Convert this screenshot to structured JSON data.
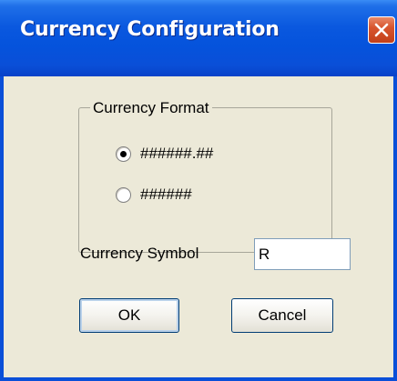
{
  "window": {
    "title": "Currency Configuration"
  },
  "titlebar": {
    "close_icon": "close-x-icon"
  },
  "currency_format": {
    "legend": "Currency Format",
    "options": [
      {
        "label": "######.##",
        "selected": true
      },
      {
        "label": "######",
        "selected": false
      }
    ]
  },
  "currency_symbol": {
    "label": "Currency Symbol",
    "value": "R"
  },
  "buttons": {
    "ok_label": "OK",
    "cancel_label": "Cancel"
  },
  "colors": {
    "titlebar": "#0a4fd8",
    "dialog_bg": "#ece9d8",
    "close_button": "#c2401a"
  }
}
